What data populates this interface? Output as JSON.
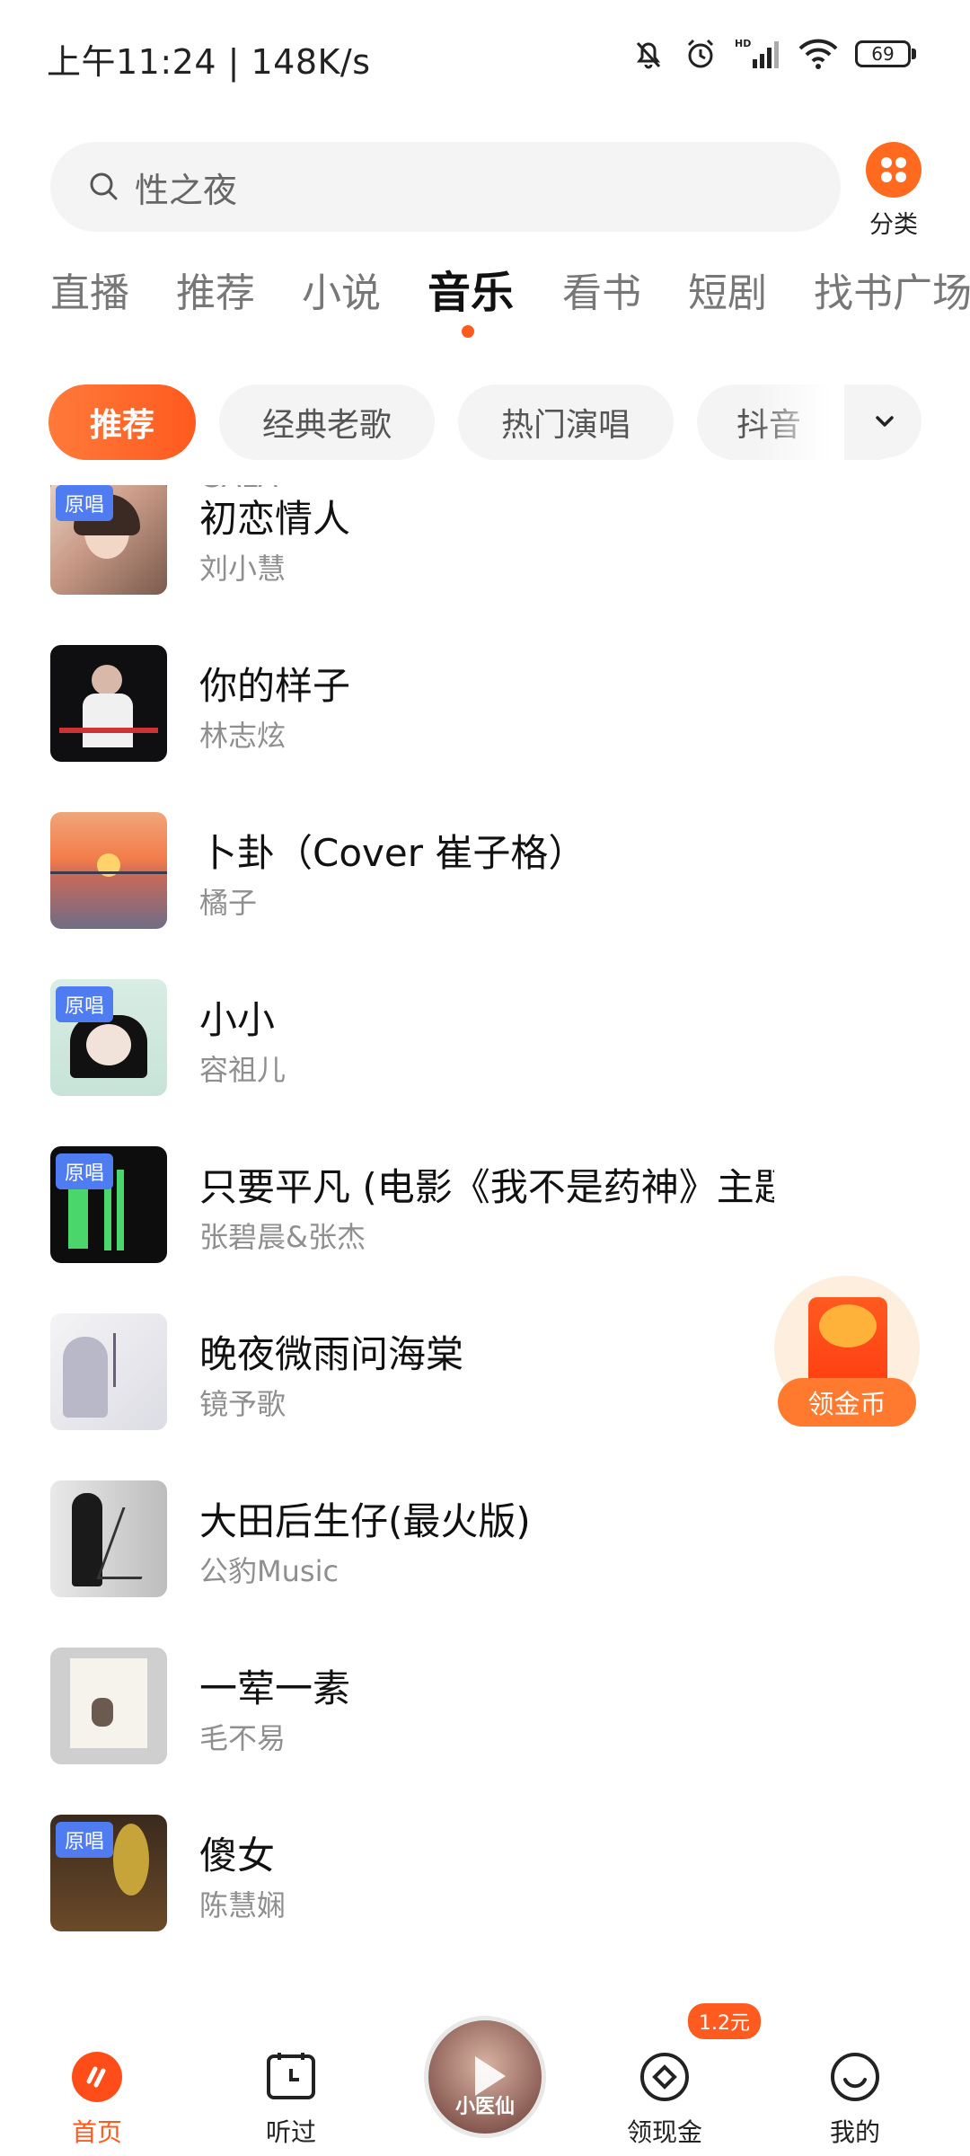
{
  "status_bar": {
    "time": "上午11:24 | 148K/s",
    "battery": "69"
  },
  "search": {
    "placeholder": "性之夜"
  },
  "category_button": {
    "label": "分类"
  },
  "channel_tabs": [
    {
      "label": "直播"
    },
    {
      "label": "推荐"
    },
    {
      "label": "小说"
    },
    {
      "label": "音乐"
    },
    {
      "label": "看书"
    },
    {
      "label": "短剧"
    },
    {
      "label": "找书广场"
    }
  ],
  "filter_chips": [
    {
      "label": "推荐"
    },
    {
      "label": "经典老歌"
    },
    {
      "label": "热门演唱"
    },
    {
      "label": "抖音"
    }
  ],
  "songs": [
    {
      "title": "",
      "artist": "GALA",
      "badge": ""
    },
    {
      "title": "初恋情人",
      "artist": "刘小慧",
      "badge": "原唱"
    },
    {
      "title": "你的样子",
      "artist": "林志炫",
      "badge": ""
    },
    {
      "title": "卜卦（Cover 崔子格）",
      "artist": "橘子",
      "badge": ""
    },
    {
      "title": "小小",
      "artist": "容祖儿",
      "badge": "原唱"
    },
    {
      "title": "只要平凡 (电影《我不是药神》主题曲)",
      "artist": "张碧晨&张杰",
      "badge": "原唱"
    },
    {
      "title": "晚夜微雨问海棠",
      "artist": "镜予歌",
      "badge": ""
    },
    {
      "title": "大田后生仔(最火版)",
      "artist": "公豹Music",
      "badge": ""
    },
    {
      "title": "一荤一素",
      "artist": "毛不易",
      "badge": ""
    },
    {
      "title": "傻女",
      "artist": "陈慧娴",
      "badge": "原唱"
    }
  ],
  "coin_widget": {
    "label": "领金币"
  },
  "bottom_nav": {
    "home": "首页",
    "history": "听过",
    "player_disc_text": "小医仙",
    "cash": "领现金",
    "cash_badge": "1.2元",
    "me": "我的"
  },
  "colors": {
    "accent": "#ff5a1f",
    "badge_blue": "#4f7cf0"
  }
}
